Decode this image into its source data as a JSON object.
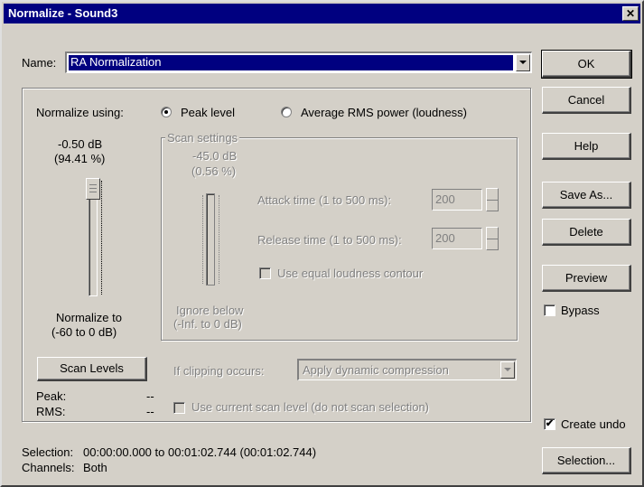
{
  "window": {
    "title": "Normalize - Sound3",
    "close_glyph": "✕"
  },
  "preset": {
    "label": "Name:",
    "value": "RA Normalization"
  },
  "buttons": {
    "ok": "OK",
    "cancel": "Cancel",
    "help": "Help",
    "save_as": "Save As...",
    "delete": "Delete",
    "preview": "Preview",
    "selection": "Selection...",
    "scan_levels": "Scan Levels"
  },
  "normalize": {
    "using_label": "Normalize using:",
    "peak_label": "Peak level",
    "rms_label": "Average RMS power (loudness)",
    "selected": "peak",
    "level_db": "-0.50 dB",
    "level_pct": "(94.41 %)",
    "to_label": "Normalize to",
    "to_range": "(-60 to 0 dB)",
    "slider_level": 0.99
  },
  "scan": {
    "group_label": "Scan settings",
    "db": "-45.0 dB",
    "pct": "(0.56 %)",
    "attack_label": "Attack time (1 to 500 ms):",
    "attack_value": "200",
    "release_label": "Release time (1 to 500 ms):",
    "release_value": "200",
    "equal_loudness_label": "Use equal loudness contour",
    "ignore_label": "Ignore below",
    "ignore_range": "(-Inf. to 0 dB)"
  },
  "clipping": {
    "label": "If clipping occurs:",
    "value": "Apply dynamic compression"
  },
  "use_current_label": "Use current scan level (do not scan selection)",
  "stats": {
    "peak_label": "Peak:",
    "peak_value": "--",
    "rms_label": "RMS:",
    "rms_value": "--"
  },
  "bypass": {
    "label": "Bypass",
    "checked": false
  },
  "create_undo": {
    "label": "Create undo",
    "checked": true,
    "check_glyph": "✔"
  },
  "footer": {
    "selection_label": "Selection:",
    "selection_value": "00:00:00.000 to 00:01:02.744 (00:01:02.744)",
    "channels_label": "Channels:",
    "channels_value": "Both"
  },
  "colors": {
    "title_bar": "#000080",
    "face": "#d4d0c8",
    "selection_highlight": "#000080"
  }
}
